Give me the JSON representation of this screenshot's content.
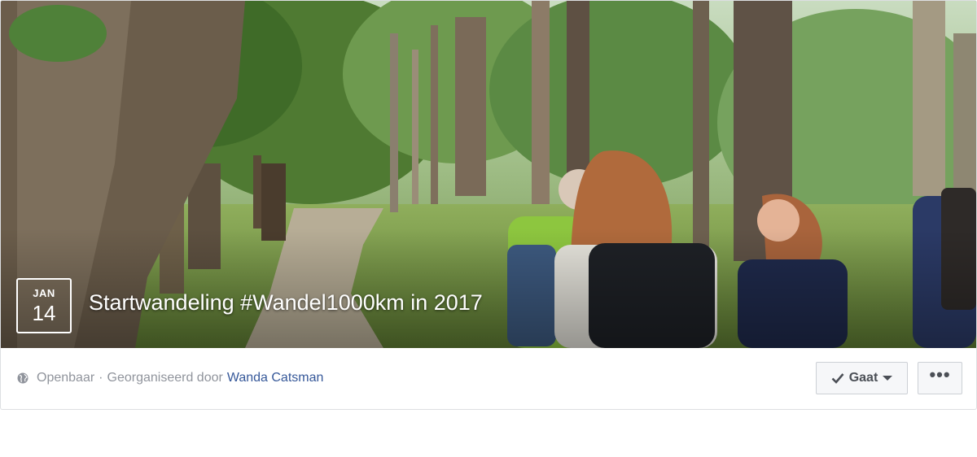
{
  "event": {
    "date_month": "JAN",
    "date_day": "14",
    "title": "Startwandeling #Wandel1000km in 2017"
  },
  "meta": {
    "privacy_label": "Openbaar",
    "separator": "·",
    "organized_by_label": "Georganiseerd door",
    "organizer_name": "Wanda Catsman"
  },
  "actions": {
    "going_label": "Gaat",
    "more_label": "•••"
  },
  "colors": {
    "link": "#365899",
    "meta_text": "#90949c",
    "button_bg": "#f6f7f9",
    "button_border": "#ccd0d5"
  },
  "icons": {
    "privacy": "globe-icon",
    "going": "check-icon",
    "going_dropdown": "caret-down-icon",
    "more": "more-dots-icon"
  }
}
